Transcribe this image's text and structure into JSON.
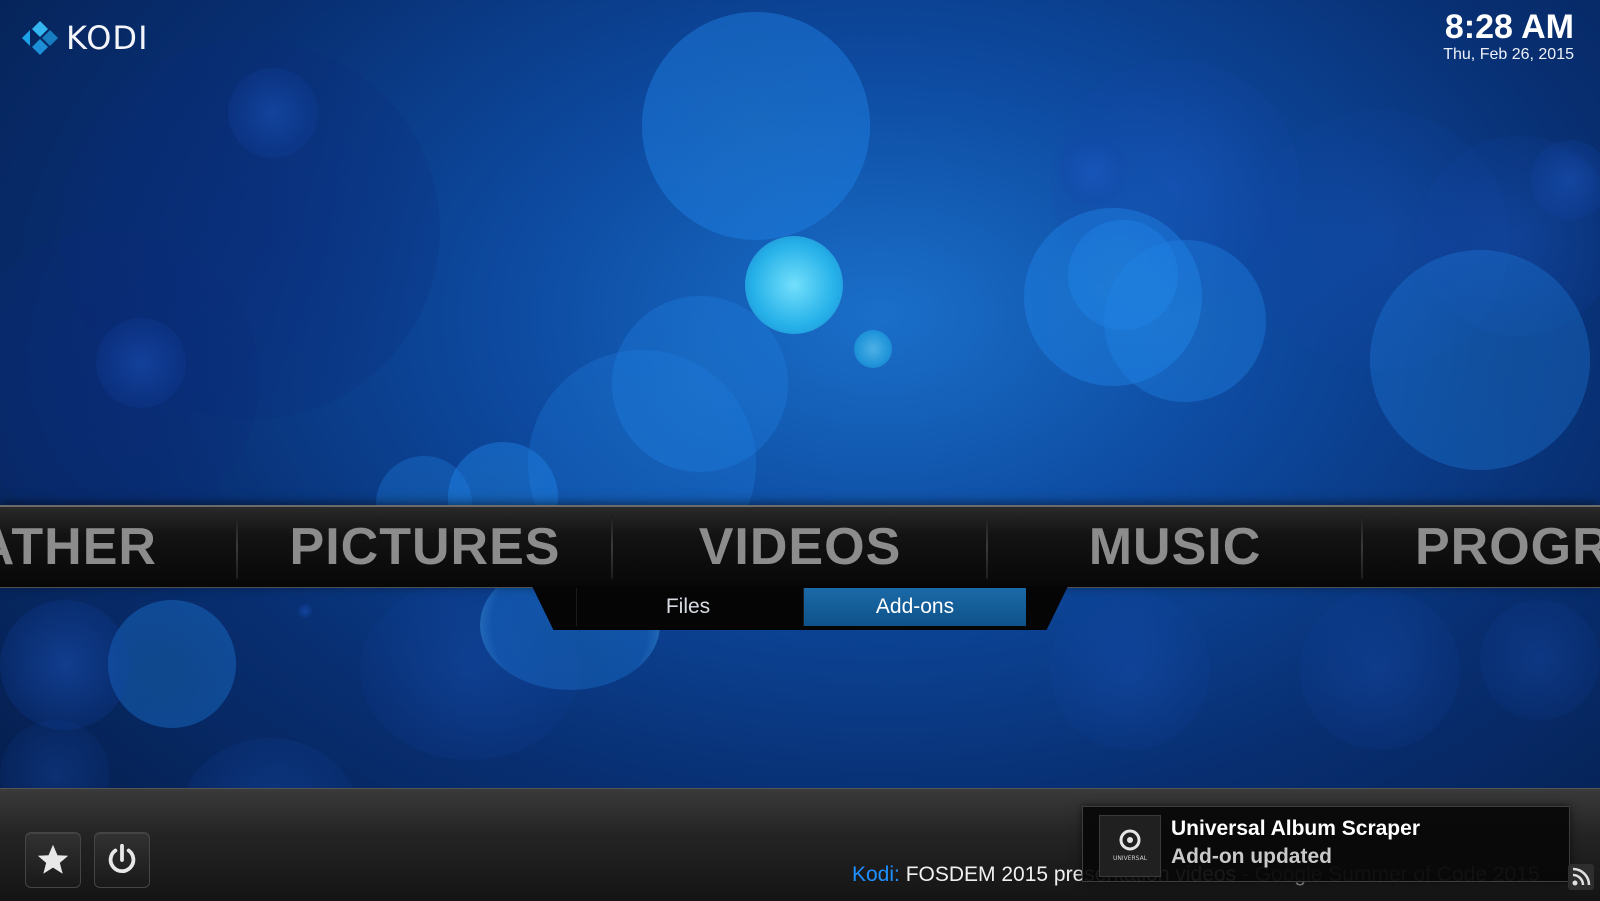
{
  "app": {
    "logo_text": "KODI"
  },
  "clock": {
    "time": "8:28 AM",
    "date": "Thu, Feb 26, 2015"
  },
  "main_menu": {
    "items": [
      {
        "label": "EATHER"
      },
      {
        "label": "PICTURES"
      },
      {
        "label": "VIDEOS"
      },
      {
        "label": "MUSIC"
      },
      {
        "label": "PROGRA"
      }
    ],
    "selected": "VIDEOS"
  },
  "submenu": {
    "items": [
      {
        "label": "Files"
      },
      {
        "label": "Add-ons"
      }
    ],
    "active": "Add-ons"
  },
  "bottom_bar": {
    "buttons": [
      {
        "icon": "star-icon"
      },
      {
        "icon": "power-icon"
      }
    ]
  },
  "ticker": {
    "source": "Kodi:",
    "text": " FOSDEM 2015 presentation videos",
    "text2": " - Google Summer of Code 2015"
  },
  "notification": {
    "title": "Universal Album Scraper",
    "message": "Add-on updated",
    "icon_caption": "UNIVERSAL"
  },
  "colors": {
    "accent": "#1e90ff",
    "active_tab": "#1a6aa8"
  }
}
